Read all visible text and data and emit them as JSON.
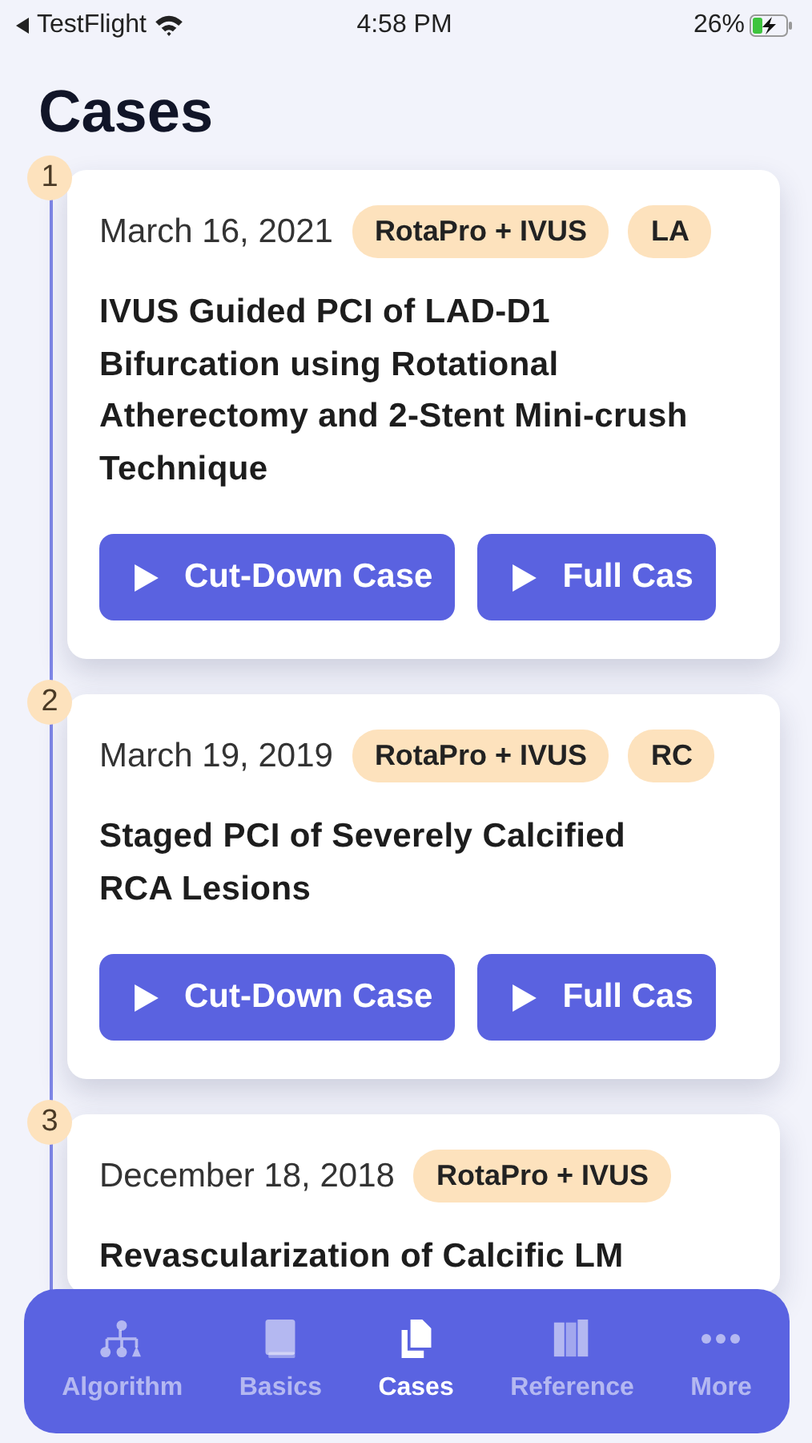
{
  "status_bar": {
    "back_label": "TestFlight",
    "time": "4:58 PM",
    "battery": "26%"
  },
  "title": "Cases",
  "cases": [
    {
      "number": "1",
      "date": "March 16, 2021",
      "tags": [
        "RotaPro + IVUS",
        "LA"
      ],
      "title": "IVUS Guided PCI of LAD-D1 Bifurcation using Rotational Atherectomy and 2-Stent Mini-crush Technique",
      "buttons": [
        "Cut-Down Case",
        "Full Cas"
      ]
    },
    {
      "number": "2",
      "date": "March 19, 2019",
      "tags": [
        "RotaPro + IVUS",
        "RC"
      ],
      "title": "Staged PCI of Severely Calcified RCA Lesions",
      "buttons": [
        "Cut-Down Case",
        "Full Cas"
      ]
    },
    {
      "number": "3",
      "date": "December 18, 2018",
      "tags": [
        "RotaPro + IVUS"
      ],
      "title": "Revascularization of Calcific LM"
    }
  ],
  "tab_bar": [
    {
      "label": "Algorithm",
      "selected": false
    },
    {
      "label": "Basics",
      "selected": false
    },
    {
      "label": "Cases",
      "selected": true
    },
    {
      "label": "Reference",
      "selected": false
    },
    {
      "label": "More",
      "selected": false
    }
  ]
}
